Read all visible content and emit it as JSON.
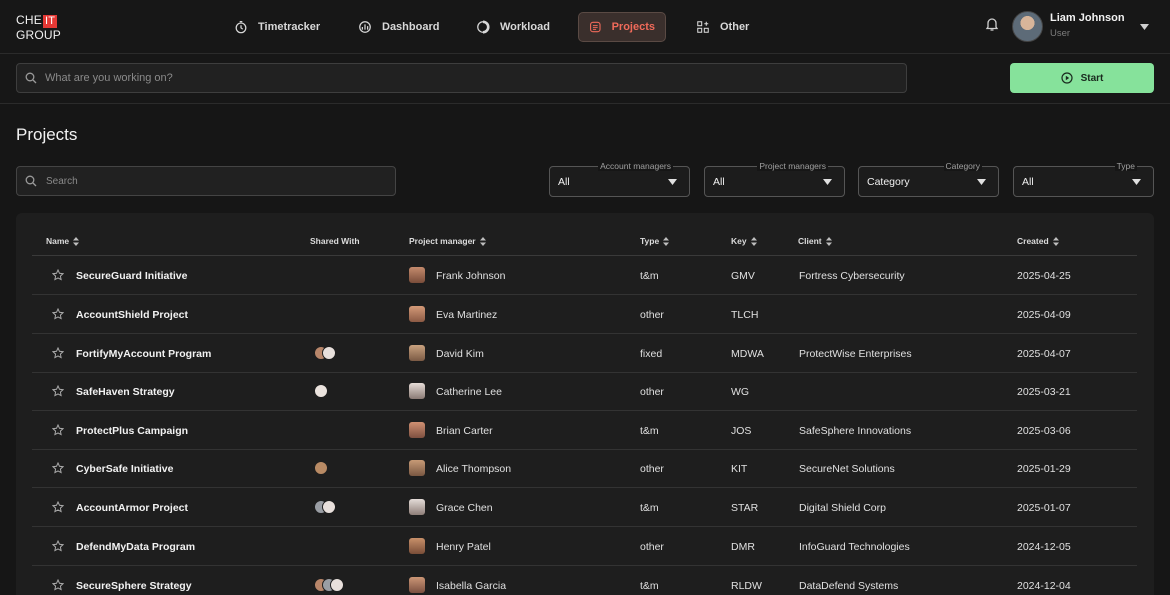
{
  "logo": {
    "line1": "CHE",
    "box": "IT",
    "line2": "GROUP"
  },
  "nav": [
    {
      "label": "Timetracker",
      "icon": "timer-icon",
      "active": false
    },
    {
      "label": "Dashboard",
      "icon": "dashboard-icon",
      "active": false
    },
    {
      "label": "Workload",
      "icon": "workload-icon",
      "active": false
    },
    {
      "label": "Projects",
      "icon": "projects-icon",
      "active": true
    },
    {
      "label": "Other",
      "icon": "grid-plus-icon",
      "active": false
    }
  ],
  "user": {
    "name": "Liam Johnson",
    "role": "User"
  },
  "workbar": {
    "placeholder": "What are you working on?",
    "start_label": "Start"
  },
  "page": {
    "title": "Projects"
  },
  "search": {
    "placeholder": "Search"
  },
  "filters": [
    {
      "legend": "Account managers",
      "value": "All"
    },
    {
      "legend": "Project managers",
      "value": "All"
    },
    {
      "legend": "Category",
      "value": "Category"
    },
    {
      "legend": "Type",
      "value": "All"
    }
  ],
  "columns": {
    "name": "Name",
    "shared": "Shared With",
    "pm": "Project manager",
    "type": "Type",
    "key": "Key",
    "client": "Client",
    "created": "Created"
  },
  "rows": [
    {
      "name": "SecureGuard Initiative",
      "pm": "Frank Johnson",
      "type": "t&m",
      "key": "GMV",
      "client": "Fortress Cybersecurity",
      "created": "2025-04-25"
    },
    {
      "name": "AccountShield Project",
      "pm": "Eva Martinez",
      "type": "other",
      "key": "TLCH",
      "client": "",
      "created": "2025-04-09"
    },
    {
      "name": "FortifyMyAccount Program",
      "pm": "David Kim",
      "type": "fixed",
      "key": "MDWA",
      "client": "ProtectWise Enterprises",
      "created": "2025-04-07"
    },
    {
      "name": "SafeHaven Strategy",
      "pm": "Catherine Lee",
      "type": "other",
      "key": "WG",
      "client": "",
      "created": "2025-03-21"
    },
    {
      "name": "ProtectPlus Campaign",
      "pm": "Brian Carter",
      "type": "t&m",
      "key": "JOS",
      "client": "SafeSphere Innovations",
      "created": "2025-03-06"
    },
    {
      "name": "CyberSafe Initiative",
      "pm": "Alice Thompson",
      "type": "other",
      "key": "KIT",
      "client": "SecureNet Solutions",
      "created": "2025-01-29"
    },
    {
      "name": "AccountArmor Project",
      "pm": "Grace Chen",
      "type": "t&m",
      "key": "STAR",
      "client": "Digital Shield Corp",
      "created": "2025-01-07"
    },
    {
      "name": "DefendMyData Program",
      "pm": "Henry Patel",
      "type": "other",
      "key": "DMR",
      "client": "InfoGuard Technologies",
      "created": "2024-12-05"
    },
    {
      "name": "SecureSphere Strategy",
      "pm": "Isabella Garcia",
      "type": "t&m",
      "key": "RLDW",
      "client": "DataDefend Systems",
      "created": "2024-12-04"
    }
  ]
}
